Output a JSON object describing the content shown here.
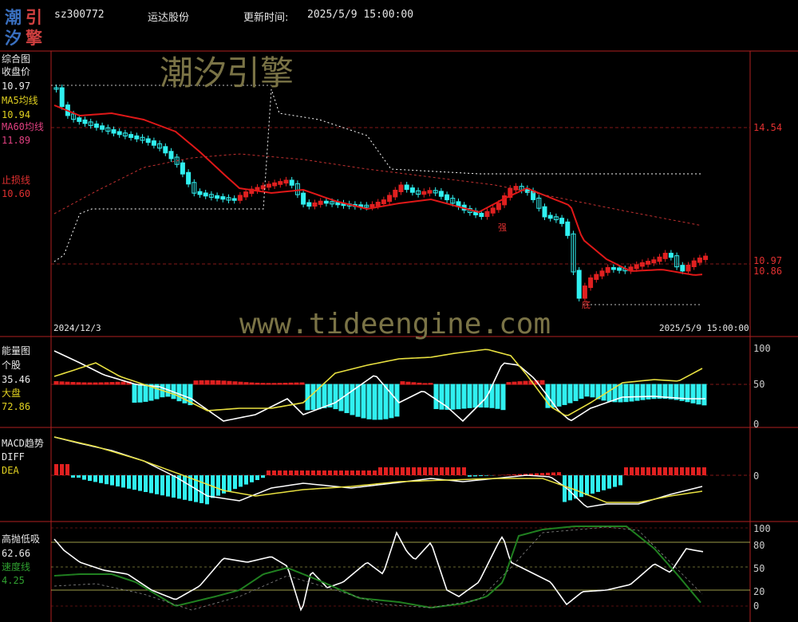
{
  "header": {
    "code": "sz300772",
    "name": "运达股份",
    "update_label": "更新时间:",
    "update_time": "2025/5/9 15:00:00"
  },
  "logo": {
    "chars": [
      "潮",
      "引",
      "汐",
      "擎"
    ]
  },
  "watermark": {
    "brand": "潮汐引擎",
    "url": "www.tideengine.com"
  },
  "panel_main": {
    "title": "综合图",
    "close_label": "收盘价",
    "close_value": "10.97",
    "ma5_label": "MA5均线",
    "ma5_value": "10.94",
    "ma60_label": "MA60均线",
    "ma60_value": "11.89",
    "stop_label": "止损线",
    "stop_value": "10.60",
    "y_labels": [
      "14.54",
      "10.97",
      "10.86"
    ],
    "start_date": "2024/12/3",
    "end_date": "2025/5/9 15:00:00",
    "mark_strong": "强",
    "mark_low": "底"
  },
  "panel_energy": {
    "title": "能量图",
    "stock_label": "个股",
    "stock_value": "35.46",
    "market_label": "大盘",
    "market_value": "72.86",
    "y_labels": [
      "100",
      "50",
      "0"
    ]
  },
  "panel_macd": {
    "title": "MACD趋势",
    "diff_label": "DIFF",
    "dea_label": "DEA",
    "y_labels": [
      "0"
    ]
  },
  "panel_hl": {
    "title": "高抛低吸",
    "value": "62.66",
    "speed_label": "速度线",
    "speed_value": "4.25",
    "y_labels": [
      "100",
      "80",
      "50",
      "20",
      "0"
    ]
  },
  "colors": {
    "up": "#e02020",
    "down": "#30f0f0",
    "ma5": "#e01818",
    "ma60": "#c03030",
    "grid": "#b02020",
    "white_line": "#ffffff",
    "yellow_line": "#e8e040",
    "green_line": "#208020"
  }
}
